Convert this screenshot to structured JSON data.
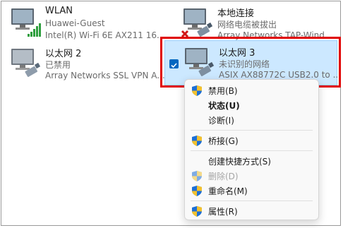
{
  "adapters": [
    {
      "name": "WLAN",
      "line1": "Huawei-Guest",
      "line2": "Intel(R) Wi-Fi 6E AX211 16..."
    },
    {
      "name": "本地连接",
      "line1": "网络电缆被拔出",
      "line2": "Array Networks TAP-Wind..."
    },
    {
      "name": "以太网 2",
      "line1": "已禁用",
      "line2": "Array Networks SSL VPN A..."
    },
    {
      "name": "以太网 3",
      "line1": "未识别的网络",
      "line2": "ASIX AX88772C USB2.0 to ..."
    }
  ],
  "context_menu": {
    "items": [
      {
        "label": "禁用(B)",
        "shield": true
      },
      {
        "label": "状态(U)"
      },
      {
        "label": "诊断(I)"
      },
      {
        "label": "桥接(G)",
        "shield": true
      },
      {
        "label": "创建快捷方式(S)"
      },
      {
        "label": "删除(D)",
        "shield": true
      },
      {
        "label": "重命名(M)",
        "shield": true
      },
      {
        "label": "属性(R)",
        "shield": true
      }
    ]
  },
  "colors": {
    "selection_bg": "#cce8ff",
    "highlight_border": "#e00000",
    "checkbox": "#0067c0",
    "disabled_text": "#a6a6a6"
  },
  "icons": {
    "monitor": "monitor-icon",
    "wifi_bars": "wifi-signal-icon",
    "ethernet_plug": "ethernet-cable-icon",
    "disconnected": "red-x-icon",
    "uac_shield": "uac-shield-icon",
    "checkbox": "checkmark-icon"
  }
}
